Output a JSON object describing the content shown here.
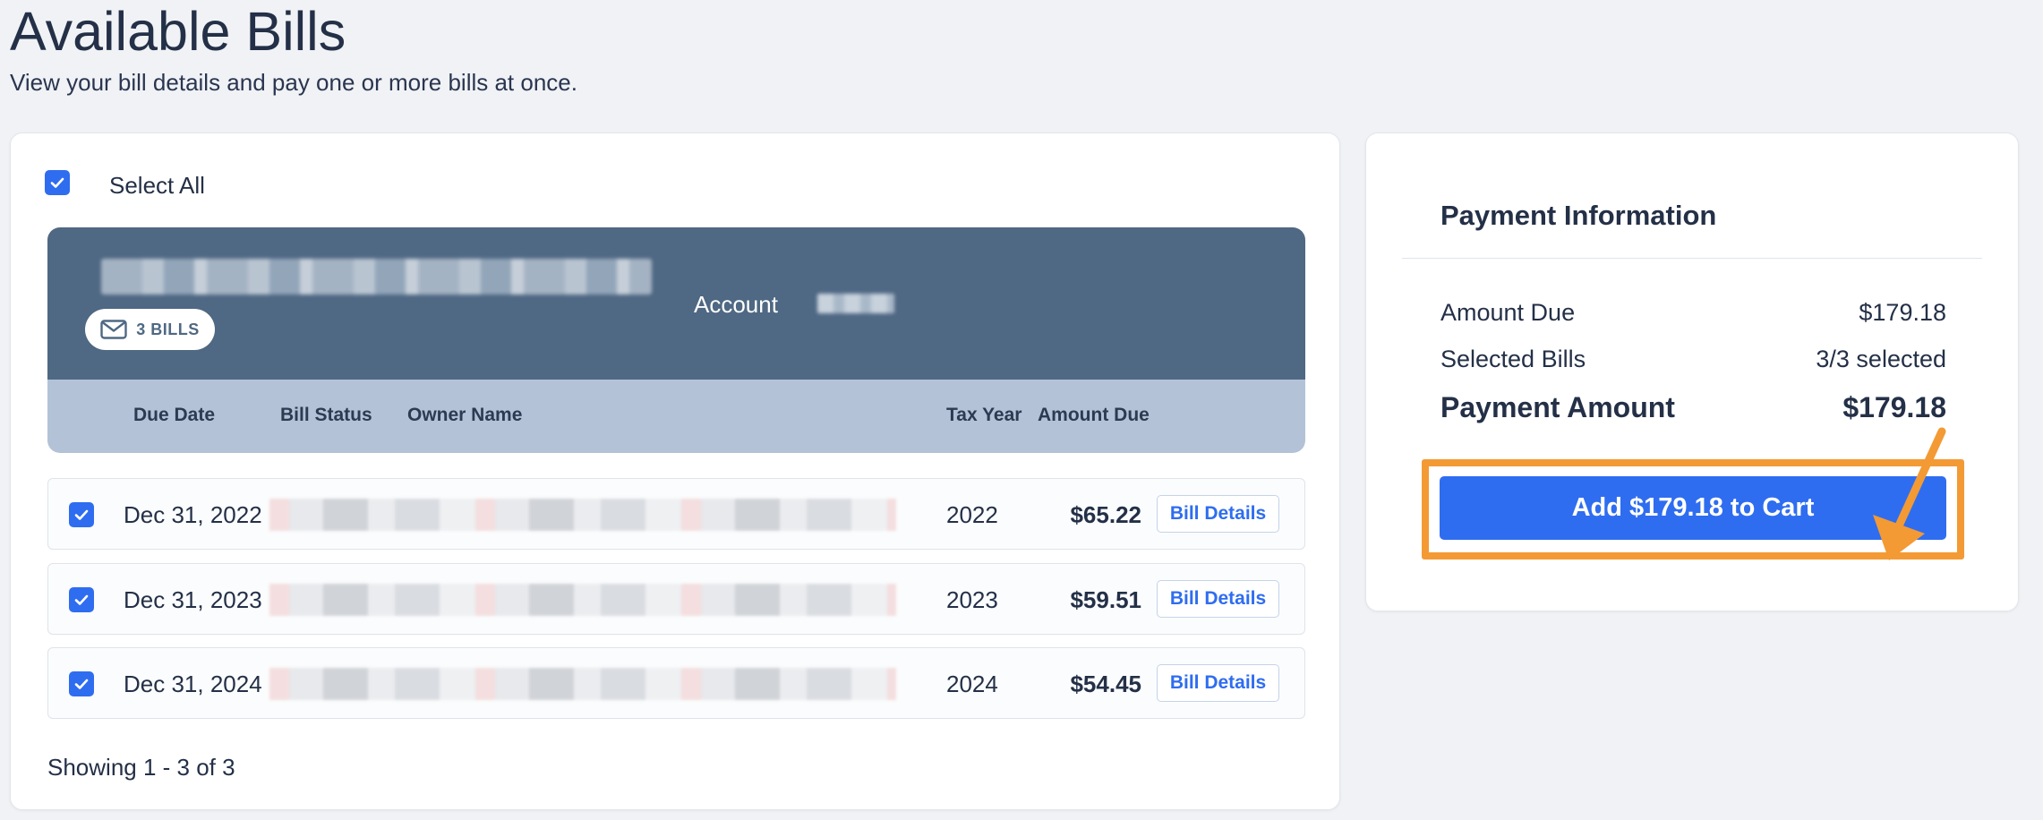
{
  "page": {
    "title": "Available Bills",
    "subtitle": "View your bill details and pay one or more bills at once."
  },
  "bills_panel": {
    "select_all_label": "Select All",
    "select_all_checked": true,
    "account": {
      "bills_badge": "3 BILLS",
      "account_label": "Account",
      "badge_icon": "envelope-icon"
    },
    "columns": {
      "due_date": "Due Date",
      "bill_status": "Bill Status",
      "owner_name": "Owner Name",
      "tax_year": "Tax Year",
      "amount_due": "Amount Due"
    },
    "rows": [
      {
        "checked": true,
        "due_date": "Dec 31, 2022",
        "tax_year": "2022",
        "amount": "$65.22",
        "details_label": "Bill Details"
      },
      {
        "checked": true,
        "due_date": "Dec 31, 2023",
        "tax_year": "2023",
        "amount": "$59.51",
        "details_label": "Bill Details"
      },
      {
        "checked": true,
        "due_date": "Dec 31, 2024",
        "tax_year": "2024",
        "amount": "$54.45",
        "details_label": "Bill Details"
      }
    ],
    "showing": "Showing 1 - 3 of 3"
  },
  "payment": {
    "title": "Payment Information",
    "amount_due_label": "Amount Due",
    "amount_due_value": "$179.18",
    "selected_bills_label": "Selected Bills",
    "selected_bills_value": "3/3 selected",
    "payment_amount_label": "Payment Amount",
    "payment_amount_value": "$179.18",
    "cta_label": "Add $179.18 to Cart"
  },
  "colors": {
    "accent": "#2f6df0",
    "header": "#4f6883",
    "column_header": "#b3c2d6",
    "highlight": "#f39a34"
  }
}
